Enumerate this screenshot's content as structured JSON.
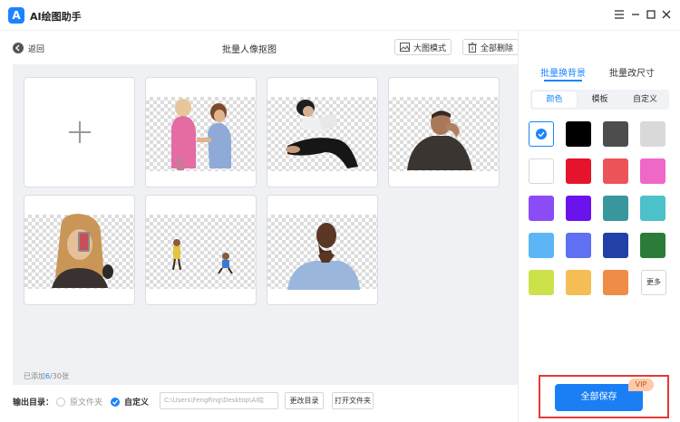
{
  "app": {
    "title": "AI绘图助手",
    "logo_letter": "A"
  },
  "toolbar": {
    "back_label": "返回",
    "page_title": "批量人像抠图",
    "large_view_label": "大图模式",
    "delete_all_label": "全部删除"
  },
  "grid": {
    "add_label": "+",
    "count_prefix": "已添加",
    "count_current": "6",
    "count_suffix": "/30张",
    "images": [
      {
        "name": "two-girls-image"
      },
      {
        "name": "woman-reading-image"
      },
      {
        "name": "thinking-man-image"
      },
      {
        "name": "woman-selfie-image"
      },
      {
        "name": "kids-playing-image"
      },
      {
        "name": "pondering-man-image"
      }
    ]
  },
  "output": {
    "label": "输出目录：",
    "option_original": "原文件夹",
    "option_custom": "自定义",
    "selected": "custom",
    "path_value": "C:\\Users\\FengFing\\Desktop\\AI绘",
    "change_dir_label": "更改目录",
    "open_folder_label": "打开文件夹"
  },
  "panel": {
    "tab_background": "批量换背景",
    "tab_resize": "批量改尺寸",
    "active_tab": "background",
    "seg_color": "颜色",
    "seg_template": "模板",
    "seg_custom": "自定义",
    "more_label": "更多",
    "swatches": [
      {
        "color": "#ffffff",
        "name": "transparent",
        "selected": true
      },
      {
        "color": "#000000",
        "name": "black"
      },
      {
        "color": "#4d4d4d",
        "name": "dark-gray"
      },
      {
        "color": "#d9d9d9",
        "name": "light-gray"
      },
      {
        "color": "#ffffff",
        "name": "white"
      },
      {
        "color": "#e5132b",
        "name": "red"
      },
      {
        "color": "#ec5459",
        "name": "light-red"
      },
      {
        "color": "#ef67c7",
        "name": "pink"
      },
      {
        "color": "#8b4cf7",
        "name": "violet"
      },
      {
        "color": "#6a13ec",
        "name": "purple"
      },
      {
        "color": "#37979c",
        "name": "teal"
      },
      {
        "color": "#4dc1ca",
        "name": "cyan"
      },
      {
        "color": "#5db5f6",
        "name": "sky-blue"
      },
      {
        "color": "#5f70f2",
        "name": "blue"
      },
      {
        "color": "#2141a8",
        "name": "navy"
      },
      {
        "color": "#2c7c39",
        "name": "green"
      },
      {
        "color": "#cde14b",
        "name": "lime"
      },
      {
        "color": "#f4bd55",
        "name": "yellow-orange"
      },
      {
        "color": "#ef8c48",
        "name": "orange"
      }
    ],
    "save_all_label": "全部保存",
    "vip_label": "VIP"
  },
  "colors": {
    "accent": "#1a84ff",
    "highlight_border": "#e53935"
  }
}
